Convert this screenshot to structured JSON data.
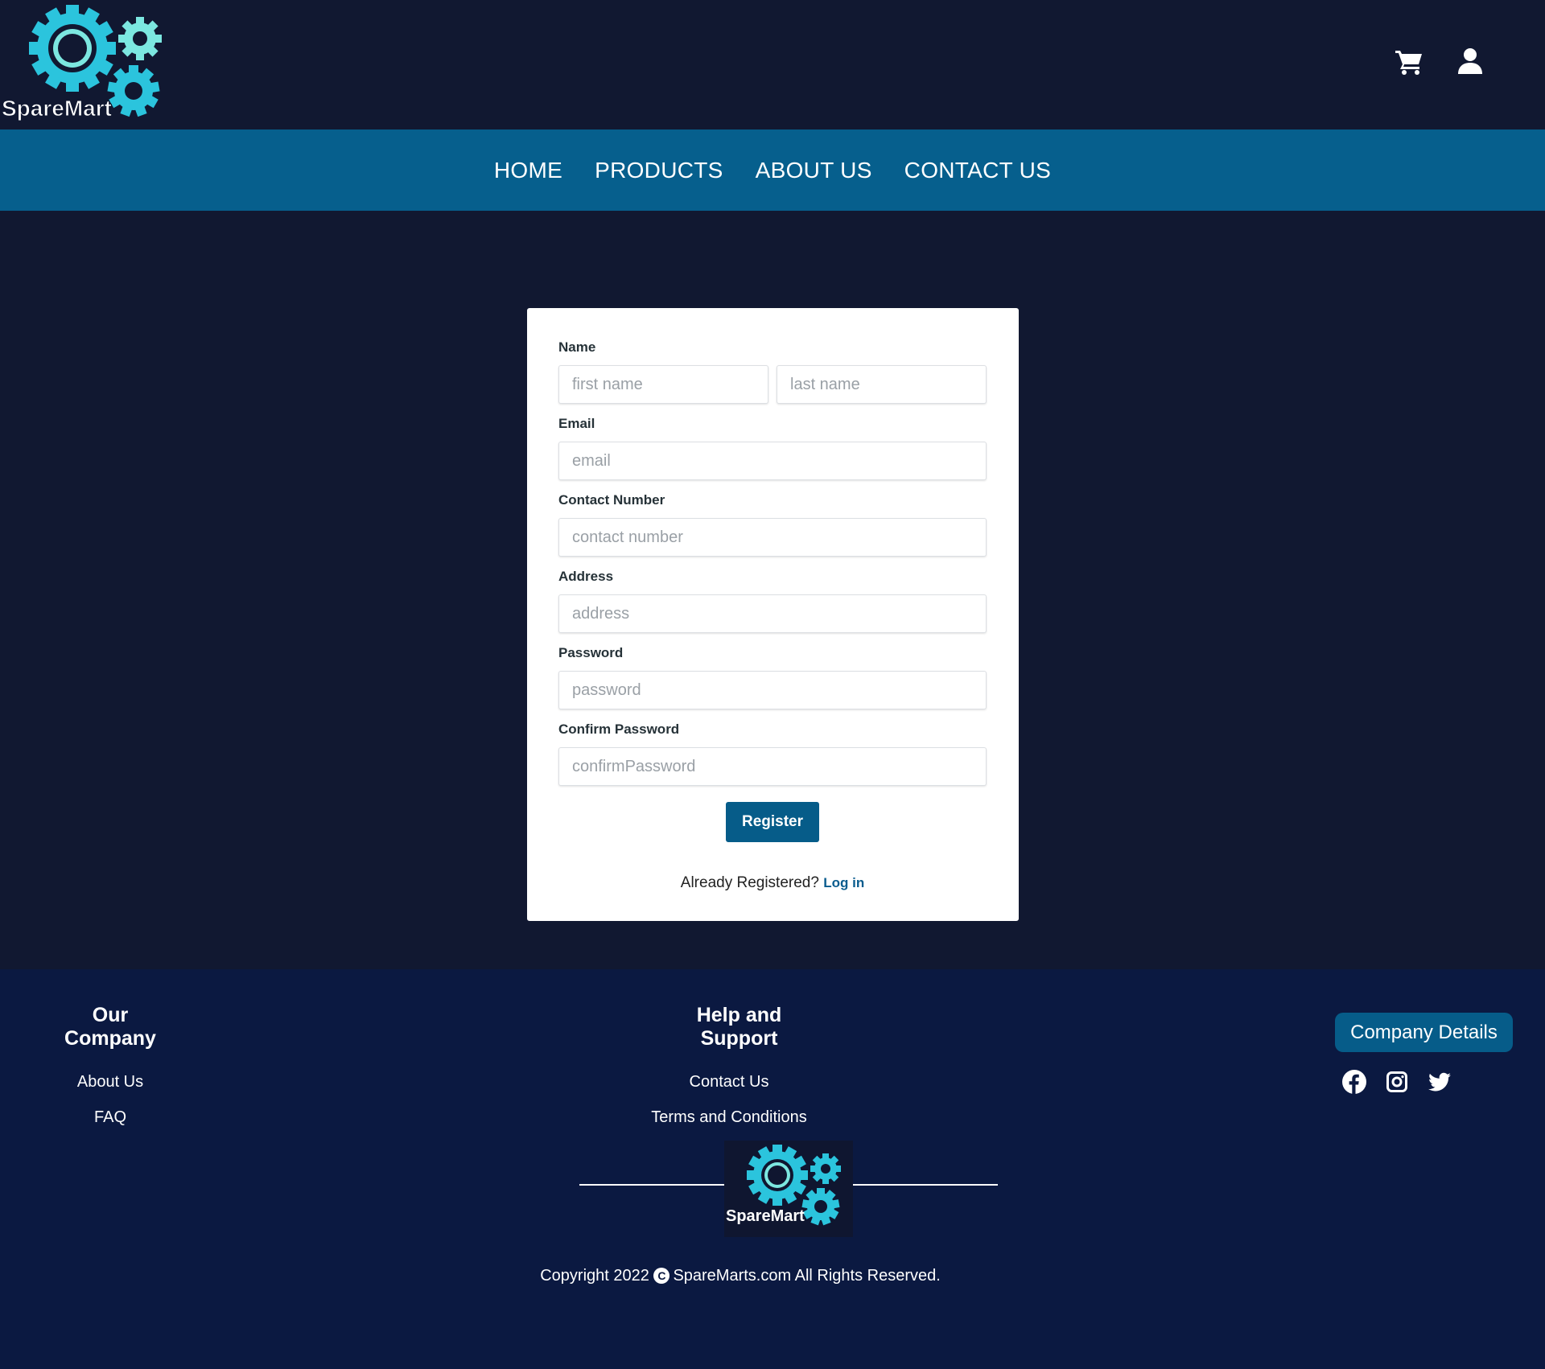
{
  "brand": {
    "name": "SpareMart",
    "colors": {
      "teal": "#2bc4dd",
      "mint": "#7ce7e0",
      "nav": "#065f8d",
      "bg": "#111831",
      "footer": "#0b1941",
      "button": "#065c89"
    }
  },
  "header": {
    "icons": [
      "cart-icon",
      "user-icon"
    ]
  },
  "nav": {
    "items": [
      "HOME",
      "PRODUCTS",
      "ABOUT US",
      "CONTACT US"
    ]
  },
  "form": {
    "name_label": "Name",
    "first_name_placeholder": "first name",
    "last_name_placeholder": "last name",
    "email_label": "Email",
    "email_placeholder": "email",
    "contact_label": "Contact Number",
    "contact_placeholder": "contact number",
    "address_label": "Address",
    "address_placeholder": "address",
    "password_label": "Password",
    "password_placeholder": "password",
    "confirm_label": "Confirm Password",
    "confirm_placeholder": "confirmPassword",
    "register_label": "Register",
    "already_text": "Already Registered?",
    "login_link": "Log in"
  },
  "footer": {
    "col1_title": "Our Company",
    "col1_links": [
      "About Us",
      "FAQ"
    ],
    "col2_title": "Help and Support",
    "col2_links": [
      "Contact Us",
      "Terms and Conditions"
    ],
    "company_button": "Company Details",
    "social_icons": [
      "facebook-icon",
      "instagram-icon",
      "twitter-icon"
    ],
    "copyright_before": "Copyright 2022",
    "copyright_symbol": "C",
    "copyright_after": "SpareMarts.com All Rights Reserved."
  }
}
